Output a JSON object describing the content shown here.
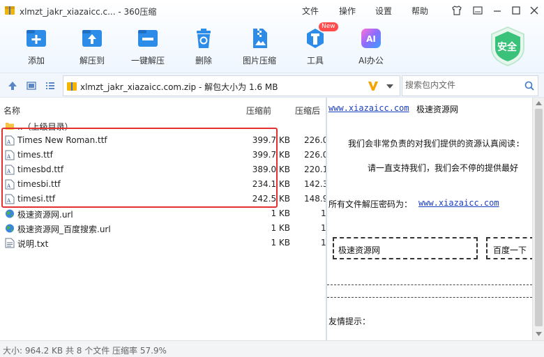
{
  "window": {
    "title": "xlmzt_jakr_xiazaicc.c... - 360压缩",
    "menus": [
      "文件",
      "操作",
      "设置",
      "帮助"
    ]
  },
  "toolbar": {
    "add": "添加",
    "extract_to": "解压到",
    "one_click_extract": "一键解压",
    "delete": "删除",
    "image_compress": "图片压缩",
    "tools": "工具",
    "tools_badge": "New",
    "ai_office": "AI办公",
    "ai_icon_text": "AI",
    "safety": "安全"
  },
  "address": {
    "path": "xlmzt_jakr_xiazaicc.com.zip - 解包大小为 1.6 MB",
    "search_placeholder": "搜索包内文件"
  },
  "columns": {
    "name": "名称",
    "before": "压缩前",
    "after": "压缩后"
  },
  "files": [
    {
      "name": "..（上级目录）",
      "size": "",
      "comp": "",
      "icon": "folder-up-icon"
    },
    {
      "name": "Times New Roman.ttf",
      "size": "399.7 KB",
      "comp": "226.0",
      "icon": "font-file-icon"
    },
    {
      "name": "times.ttf",
      "size": "399.7 KB",
      "comp": "226.0",
      "icon": "font-file-icon"
    },
    {
      "name": "timesbd.ttf",
      "size": "389.0 KB",
      "comp": "220.1",
      "icon": "font-file-icon"
    },
    {
      "name": "timesbi.ttf",
      "size": "234.1 KB",
      "comp": "142.3",
      "icon": "font-file-icon"
    },
    {
      "name": "timesi.ttf",
      "size": "242.5 KB",
      "comp": "148.9",
      "icon": "font-file-icon"
    },
    {
      "name": "极速资源网.url",
      "size": "1 KB",
      "comp": "1",
      "icon": "url-globe-icon"
    },
    {
      "name": "极速资源网_百度搜索.url",
      "size": "1 KB",
      "comp": "1",
      "icon": "url-globe-icon"
    },
    {
      "name": "说明.txt",
      "size": "1 KB",
      "comp": "1",
      "icon": "text-file-icon"
    }
  ],
  "preview": {
    "site_link": "www.xiazaicc.com",
    "site_name": "极速资源网",
    "line1": "我们会非常负责的对我们提供的资源认真阅读:",
    "line2": "请一直支持我们，我们会不停的提供最好",
    "password_label": "所有文件解压密码为：",
    "password_link": "www.xiazaicc.com",
    "box1": "极速资源网",
    "box2": "百度一下",
    "tip": "友情提示："
  },
  "status": {
    "text": "大小: 964.2 KB 共 8 个文件 压缩率 57.9%"
  },
  "colors": {
    "accent": "#2d8ce8",
    "highlight_border": "#e23030",
    "link": "#1a3fbf",
    "safety_green": "#3bc27a"
  }
}
